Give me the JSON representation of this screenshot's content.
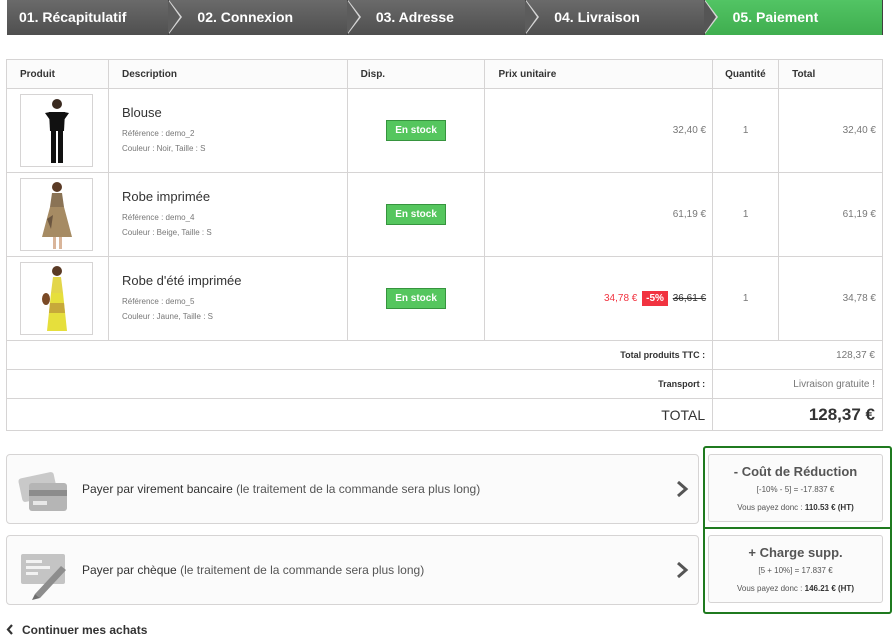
{
  "steps": [
    {
      "label": "01. Récapitulatif"
    },
    {
      "label": "02. Connexion"
    },
    {
      "label": "03. Adresse"
    },
    {
      "label": "04. Livraison"
    },
    {
      "label": "05. Paiement"
    }
  ],
  "table": {
    "headers": {
      "product": "Produit",
      "description": "Description",
      "availability": "Disp.",
      "unit_price": "Prix unitaire",
      "quantity": "Quantité",
      "total": "Total"
    },
    "items": [
      {
        "name": "Blouse",
        "reference": "Référence : demo_2",
        "attributes": "Couleur : Noir, Taille : S",
        "stock": "En stock",
        "price": "32,40 €",
        "quantity": "1",
        "total": "32,40 €"
      },
      {
        "name": "Robe imprimée",
        "reference": "Référence : demo_4",
        "attributes": "Couleur : Beige, Taille : S",
        "stock": "En stock",
        "price": "61,19 €",
        "quantity": "1",
        "total": "61,19 €"
      },
      {
        "name": "Robe d'été imprimée",
        "reference": "Référence : demo_5",
        "attributes": "Couleur : Jaune, Taille : S",
        "stock": "En stock",
        "price": "34,78 €",
        "discount": "-5%",
        "old_price": "36,61 €",
        "quantity": "1",
        "total": "34,78 €"
      }
    ],
    "summary": {
      "products_label": "Total produits TTC :",
      "products_value": "128,37 €",
      "shipping_label": "Transport :",
      "shipping_value": "Livraison gratuite !",
      "total_label": "TOTAL",
      "total_value": "128,37 €"
    }
  },
  "payments": [
    {
      "label": "Payer par virement bancaire",
      "note": "(le traitement de la commande sera plus long)",
      "icon": "bank-card-icon"
    },
    {
      "label": "Payer par chèque",
      "note": "(le traitement de la commande sera plus long)",
      "icon": "cheque-icon"
    }
  ],
  "fee_boxes": [
    {
      "title": "- Coût de Réduction",
      "formula": "[-10% - 5] = -17.837 €",
      "pay_label": "Vous payez donc :",
      "pay_value": "110.53 € (HT)"
    },
    {
      "title": "+ Charge supp.",
      "formula": "[5 + 10%] = 17.837 €",
      "pay_label": "Vous payez donc :",
      "pay_value": "146.21 € (HT)"
    }
  ],
  "continue_label": "Continuer mes achats",
  "colors": {
    "step_active": "#46b856",
    "step_inactive": "#5c5c5c",
    "stock_green": "#55c65e",
    "discount_red": "#f13340",
    "annotation_green": "#1f7a1f"
  }
}
